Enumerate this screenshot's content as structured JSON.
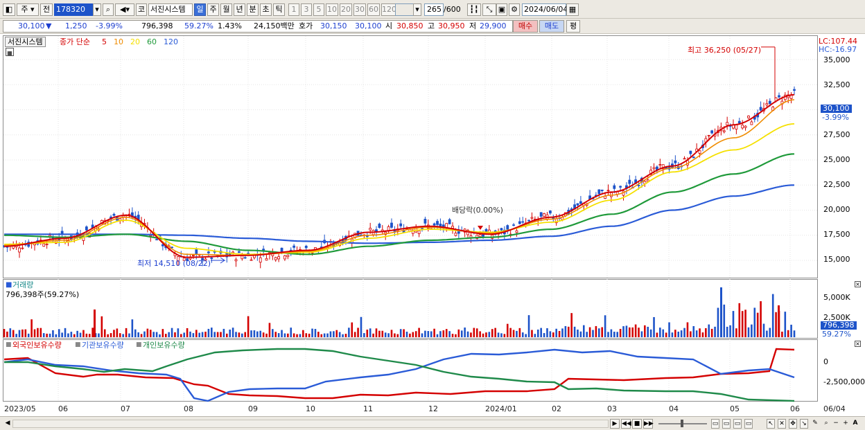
{
  "toolbar": {
    "period_label": "주",
    "prev_label": "전",
    "code_value": "178320",
    "code_icon": "search-icon",
    "kind_label": "코",
    "stock_name": "서진시스템",
    "periods": [
      "일",
      "주",
      "월",
      "년",
      "분",
      "초",
      "틱"
    ],
    "active_period": "일",
    "intervals": [
      "1",
      "3",
      "5",
      "10",
      "20",
      "30",
      "60",
      "120"
    ],
    "count_value": "265",
    "count_total": "/600",
    "date_value": "2024/06/04"
  },
  "info": {
    "price": "30,100",
    "down_arrow": "▼",
    "change": "1,250",
    "change_pct": "-3.99%",
    "volume": "796,398",
    "vol_ratio": "59.27%",
    "turnover_pct": "1.43%",
    "amount": "24,150백만",
    "quote_label": "호가",
    "ask": "30,150",
    "bid": "30,100",
    "open_label": "시",
    "open": "30,850",
    "high_label": "고",
    "high": "30,950",
    "low_label": "저",
    "low": "29,900",
    "buy_label": "매수",
    "sell_label": "매도",
    "eval_label": "평"
  },
  "price_panel": {
    "name_tag": "서진시스템",
    "ma_title": "종가 단순",
    "ma_periods": [
      "5",
      "10",
      "20",
      "60",
      "120"
    ],
    "ma_colors": [
      "#d40000",
      "#f08c00",
      "#f5e000",
      "#1f9a3a",
      "#2a5bd7"
    ],
    "lc": "LC:107.44",
    "hc": "HC:-16.97",
    "y_ticks": [
      "35,000",
      "32,500",
      "30,000",
      "27,500",
      "25,000",
      "22,500",
      "20,000",
      "17,500",
      "15,000"
    ],
    "current_tag": "30,100",
    "current_pct": "-3.99%",
    "high_note": "최고 36,250 (05/27)",
    "low_note": "최저 14,510 (08/22)",
    "div_note": "배당락(0.00%)"
  },
  "volume_panel": {
    "title": "거래량",
    "value_line": "796,398주(59.27%)",
    "y_ticks": [
      "5,000K",
      "2,500K"
    ],
    "current_tag": "796,398",
    "current_pct": "59.27%"
  },
  "holdings_panel": {
    "series_names": [
      "외국인보유수량",
      "기관보유수량",
      "개인보유수량"
    ],
    "series_colors": [
      "#d40000",
      "#2a5bd7",
      "#1f8a4a"
    ],
    "y_ticks": [
      "0",
      "-2,500,000"
    ]
  },
  "x_axis": {
    "labels": [
      "2023/05",
      "06",
      "07",
      "08",
      "09",
      "10",
      "11",
      "12",
      "2024/01",
      "02",
      "03",
      "04",
      "05",
      "06"
    ],
    "end_label": "06/04"
  },
  "chart_data": {
    "type": "line",
    "title": "서진시스템",
    "ylabel": "",
    "ylim": [
      13500,
      37500
    ],
    "x": [
      "2023/05",
      "06",
      "07",
      "08",
      "09",
      "10",
      "11",
      "12",
      "2024/01",
      "02",
      "03",
      "04",
      "05",
      "06"
    ],
    "series": [
      {
        "name": "5",
        "values": [
          16400,
          17200,
          19500,
          15300,
          15500,
          16000,
          17800,
          18400,
          17600,
          19300,
          21800,
          24400,
          28500,
          31500
        ]
      },
      {
        "name": "10",
        "values": [
          16500,
          17000,
          19300,
          15600,
          15500,
          15900,
          17500,
          18300,
          17700,
          19100,
          21500,
          24200,
          27200,
          31000
        ]
      },
      {
        "name": "20",
        "values": [
          16600,
          16800,
          19000,
          16200,
          15600,
          15800,
          17200,
          18100,
          17800,
          18800,
          21000,
          23800,
          26000,
          28600
        ]
      },
      {
        "name": "60",
        "values": [
          17500,
          17300,
          17600,
          16900,
          16000,
          15600,
          16400,
          17000,
          17300,
          18100,
          19600,
          21800,
          23600,
          25600
        ]
      },
      {
        "name": "120",
        "values": [
          17600,
          17600,
          17600,
          17500,
          17200,
          16900,
          16700,
          16800,
          17000,
          17400,
          18400,
          20000,
          21400,
          22500
        ]
      }
    ]
  },
  "footer": {
    "scroll_left": "◀",
    "scroll_right": "▶"
  }
}
